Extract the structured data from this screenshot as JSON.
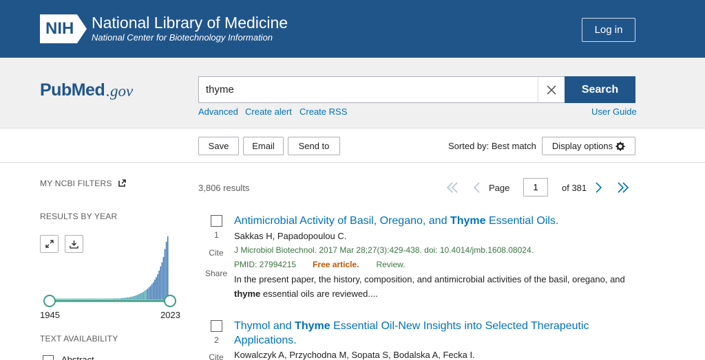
{
  "header": {
    "nih_abbr": "NIH",
    "title": "National Library of Medicine",
    "subtitle": "National Center for Biotechnology Information",
    "login_label": "Log in"
  },
  "pubmed_logo": {
    "text_pub": "Pub",
    "text_med": "Med",
    "text_gov": ".gov"
  },
  "search": {
    "query": "thyme",
    "search_label": "Search",
    "links": {
      "advanced": "Advanced",
      "create_alert": "Create alert",
      "create_rss": "Create RSS",
      "user_guide": "User Guide"
    }
  },
  "toolbar": {
    "save": "Save",
    "email": "Email",
    "send_to": "Send to",
    "sorted_by": "Sorted by: Best match",
    "display_options": "Display options"
  },
  "sidebar": {
    "my_filters": "MY NCBI FILTERS",
    "results_by_year": "RESULTS BY YEAR",
    "year_start": "1945",
    "year_end": "2023",
    "text_availability": "TEXT AVAILABILITY",
    "abstract": "Abstract"
  },
  "chart_data": {
    "type": "bar",
    "x_range": [
      "1945",
      "2023"
    ],
    "values": [
      1,
      1,
      1,
      1,
      1,
      1,
      1,
      1,
      1,
      1,
      1,
      1,
      1,
      1,
      1,
      1,
      1,
      1,
      1,
      1,
      1,
      1,
      1,
      1,
      1,
      1,
      1,
      1,
      1,
      1,
      1,
      1,
      1,
      1,
      1,
      1,
      1,
      2,
      2,
      2,
      2,
      3,
      3,
      3,
      3,
      3,
      4,
      4,
      5,
      5,
      6,
      6,
      7,
      8,
      9,
      10,
      12,
      13,
      15,
      17,
      19,
      21,
      24,
      27,
      30,
      34,
      38,
      43,
      48,
      55,
      62,
      70,
      80,
      92,
      103,
      118,
      140,
      160,
      175
    ]
  },
  "results": {
    "count": "3,806 results",
    "page_label": "Page",
    "page": "1",
    "of_pages": "of 381",
    "items": [
      {
        "num": "1",
        "cite": "Cite",
        "share": "Share",
        "title_pre": "Antimicrobial Activity of Basil, Oregano, and ",
        "title_bold": "Thyme",
        "title_post": " Essential Oils.",
        "authors": "Sakkas H, Papadopoulou C.",
        "citation": "J Microbiol Biotechnol. 2017 Mar 28;27(3):429-438. doi: 10.4014/jmb.1608.08024.",
        "pmid": "PMID: 27994215",
        "free": "Free article.",
        "review": "Review.",
        "snippet_pre": "In the present paper, the history, composition, and antimicrobial activities of the basil, oregano, and ",
        "snippet_bold": "thyme",
        "snippet_post": " essential oils are reviewed...."
      },
      {
        "num": "2",
        "cite": "Cite",
        "title_pre": "Thymol and ",
        "title_bold": "Thyme",
        "title_post": " Essential Oil-New Insights into Selected Therapeutic Applications.",
        "authors": "Kowalczyk A, Przychodna M, Sopata S, Bodalska A, Fecka I."
      }
    ]
  }
}
